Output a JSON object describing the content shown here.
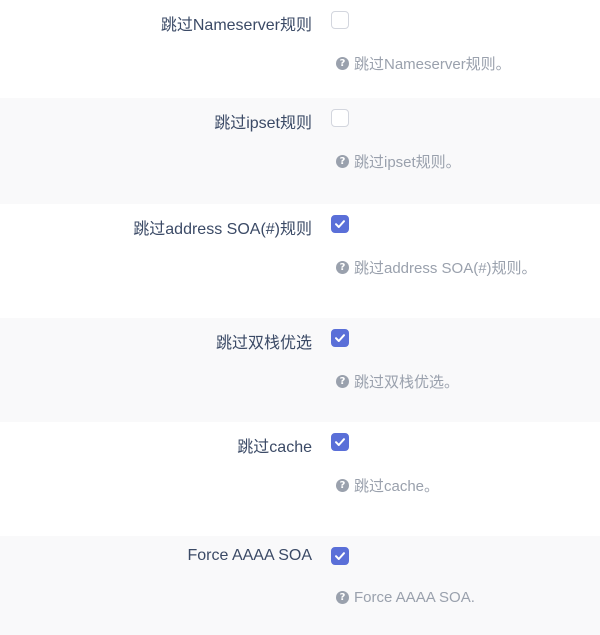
{
  "options": [
    {
      "label": "跳过Nameserver规则",
      "checked": false,
      "help": "跳过Nameserver规则。",
      "help_icon": "question-circle-icon"
    },
    {
      "label": "跳过ipset规则",
      "checked": false,
      "help": "跳过ipset规则。",
      "help_icon": "question-circle-icon"
    },
    {
      "label": "跳过address SOA(#)规则",
      "checked": true,
      "help": "跳过address SOA(#)规则。",
      "help_icon": "question-circle-icon"
    },
    {
      "label": "跳过双栈优选",
      "checked": true,
      "help": "跳过双栈优选。",
      "help_icon": "question-circle-icon"
    },
    {
      "label": "跳过cache",
      "checked": true,
      "help": "跳过cache。",
      "help_icon": "question-circle-icon"
    },
    {
      "label": "Force AAAA SOA",
      "checked": true,
      "help": "Force AAAA SOA.",
      "help_icon": "question-circle-icon"
    }
  ],
  "colors": {
    "accent": "#5a6fd8",
    "label": "#3b4a66",
    "help_text": "#9aa1ad",
    "row_alt_bg": "#f9f9fa"
  }
}
